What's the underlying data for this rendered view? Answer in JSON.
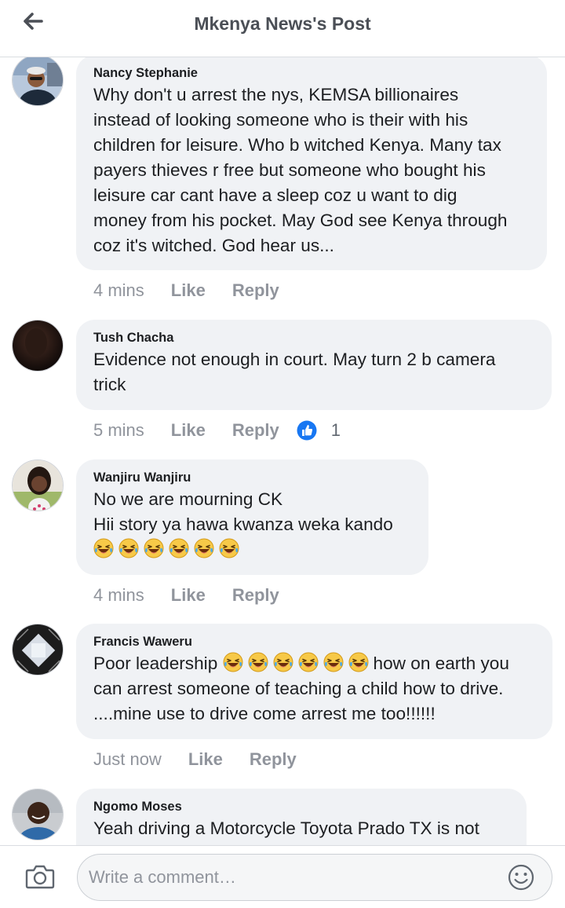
{
  "header": {
    "title": "Mkenya News's Post",
    "back_icon": "arrow-left-icon"
  },
  "comments": [
    {
      "author": "Nancy Stephanie",
      "lines": [
        "Why don't u arrest the nys, KEMSA billionaires",
        "instead of looking someone who is their with his",
        "children for leisure. Who b witched Kenya. Many tax",
        "payers thieves r free but someone who bought his",
        "leisure car cant have a sleep coz u want to dig",
        "money from his pocket. May God see Kenya through",
        "coz it's witched. God hear us..."
      ],
      "time": "4 mins",
      "like": "Like",
      "reply": "Reply"
    },
    {
      "author": "Tush Chacha",
      "lines": [
        "Evidence  not enough  in court.  May turn 2 b camera",
        "trick"
      ],
      "time": "5 mins",
      "like": "Like",
      "reply": "Reply",
      "reaction": {
        "icon": "thumbs-up-icon",
        "count": "1",
        "color": "#1877f2"
      }
    },
    {
      "author": "Wanjiru Wanjiru",
      "lines": [
        "No we are mourning CK",
        "Hii story ya hawa kwanza weka kando"
      ],
      "emoji_line": [
        "😂",
        "😂",
        "😂",
        "😂",
        "😂",
        "😂"
      ],
      "time": "4 mins",
      "like": "Like",
      "reply": "Reply"
    },
    {
      "author": "Francis Waweru",
      "line1_before": "Poor leadership ",
      "line1_emoji": [
        "😂",
        "😂",
        "😂",
        "😂",
        "😂",
        "😂"
      ],
      "line1_after": "how on earth you",
      "lines": [
        "can arrest someone of teaching a child how to drive.",
        "....mine use to drive come arrest me too!!!!!!"
      ],
      "time": "Just now",
      "like": "Like",
      "reply": "Reply"
    },
    {
      "author": "Ngomo Moses",
      "lines": [
        "Yeah driving a Motorcycle Toyota Prado TX is not"
      ]
    }
  ],
  "composer": {
    "placeholder": "Write a comment…",
    "camera_icon": "camera-icon",
    "emoji_icon": "smiley-icon"
  },
  "colors": {
    "bubble": "#f0f2f5",
    "meta_text": "#90949c",
    "accent": "#1877f2"
  }
}
